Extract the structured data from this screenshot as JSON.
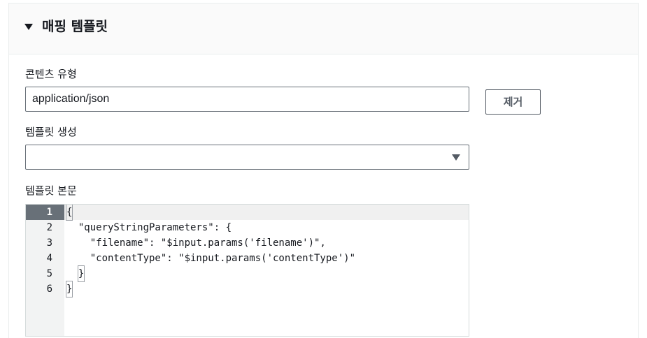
{
  "section": {
    "title": "매핑 템플릿"
  },
  "content_type": {
    "label": "콘텐츠 유형",
    "value": "application/json",
    "remove_label": "제거"
  },
  "generate_template": {
    "label": "템플릿 생성",
    "selected": ""
  },
  "template_body": {
    "label": "템플릿 본문",
    "lines": [
      {
        "num": "1",
        "code": "{"
      },
      {
        "num": "2",
        "code": "  \"queryStringParameters\": {"
      },
      {
        "num": "3",
        "code": "    \"filename\": \"$input.params('filename')\","
      },
      {
        "num": "4",
        "code": "    \"contentType\": \"$input.params('contentType')\""
      },
      {
        "num": "5",
        "code": "  }"
      },
      {
        "num": "6",
        "code": "}"
      }
    ],
    "active_line": 1
  }
}
